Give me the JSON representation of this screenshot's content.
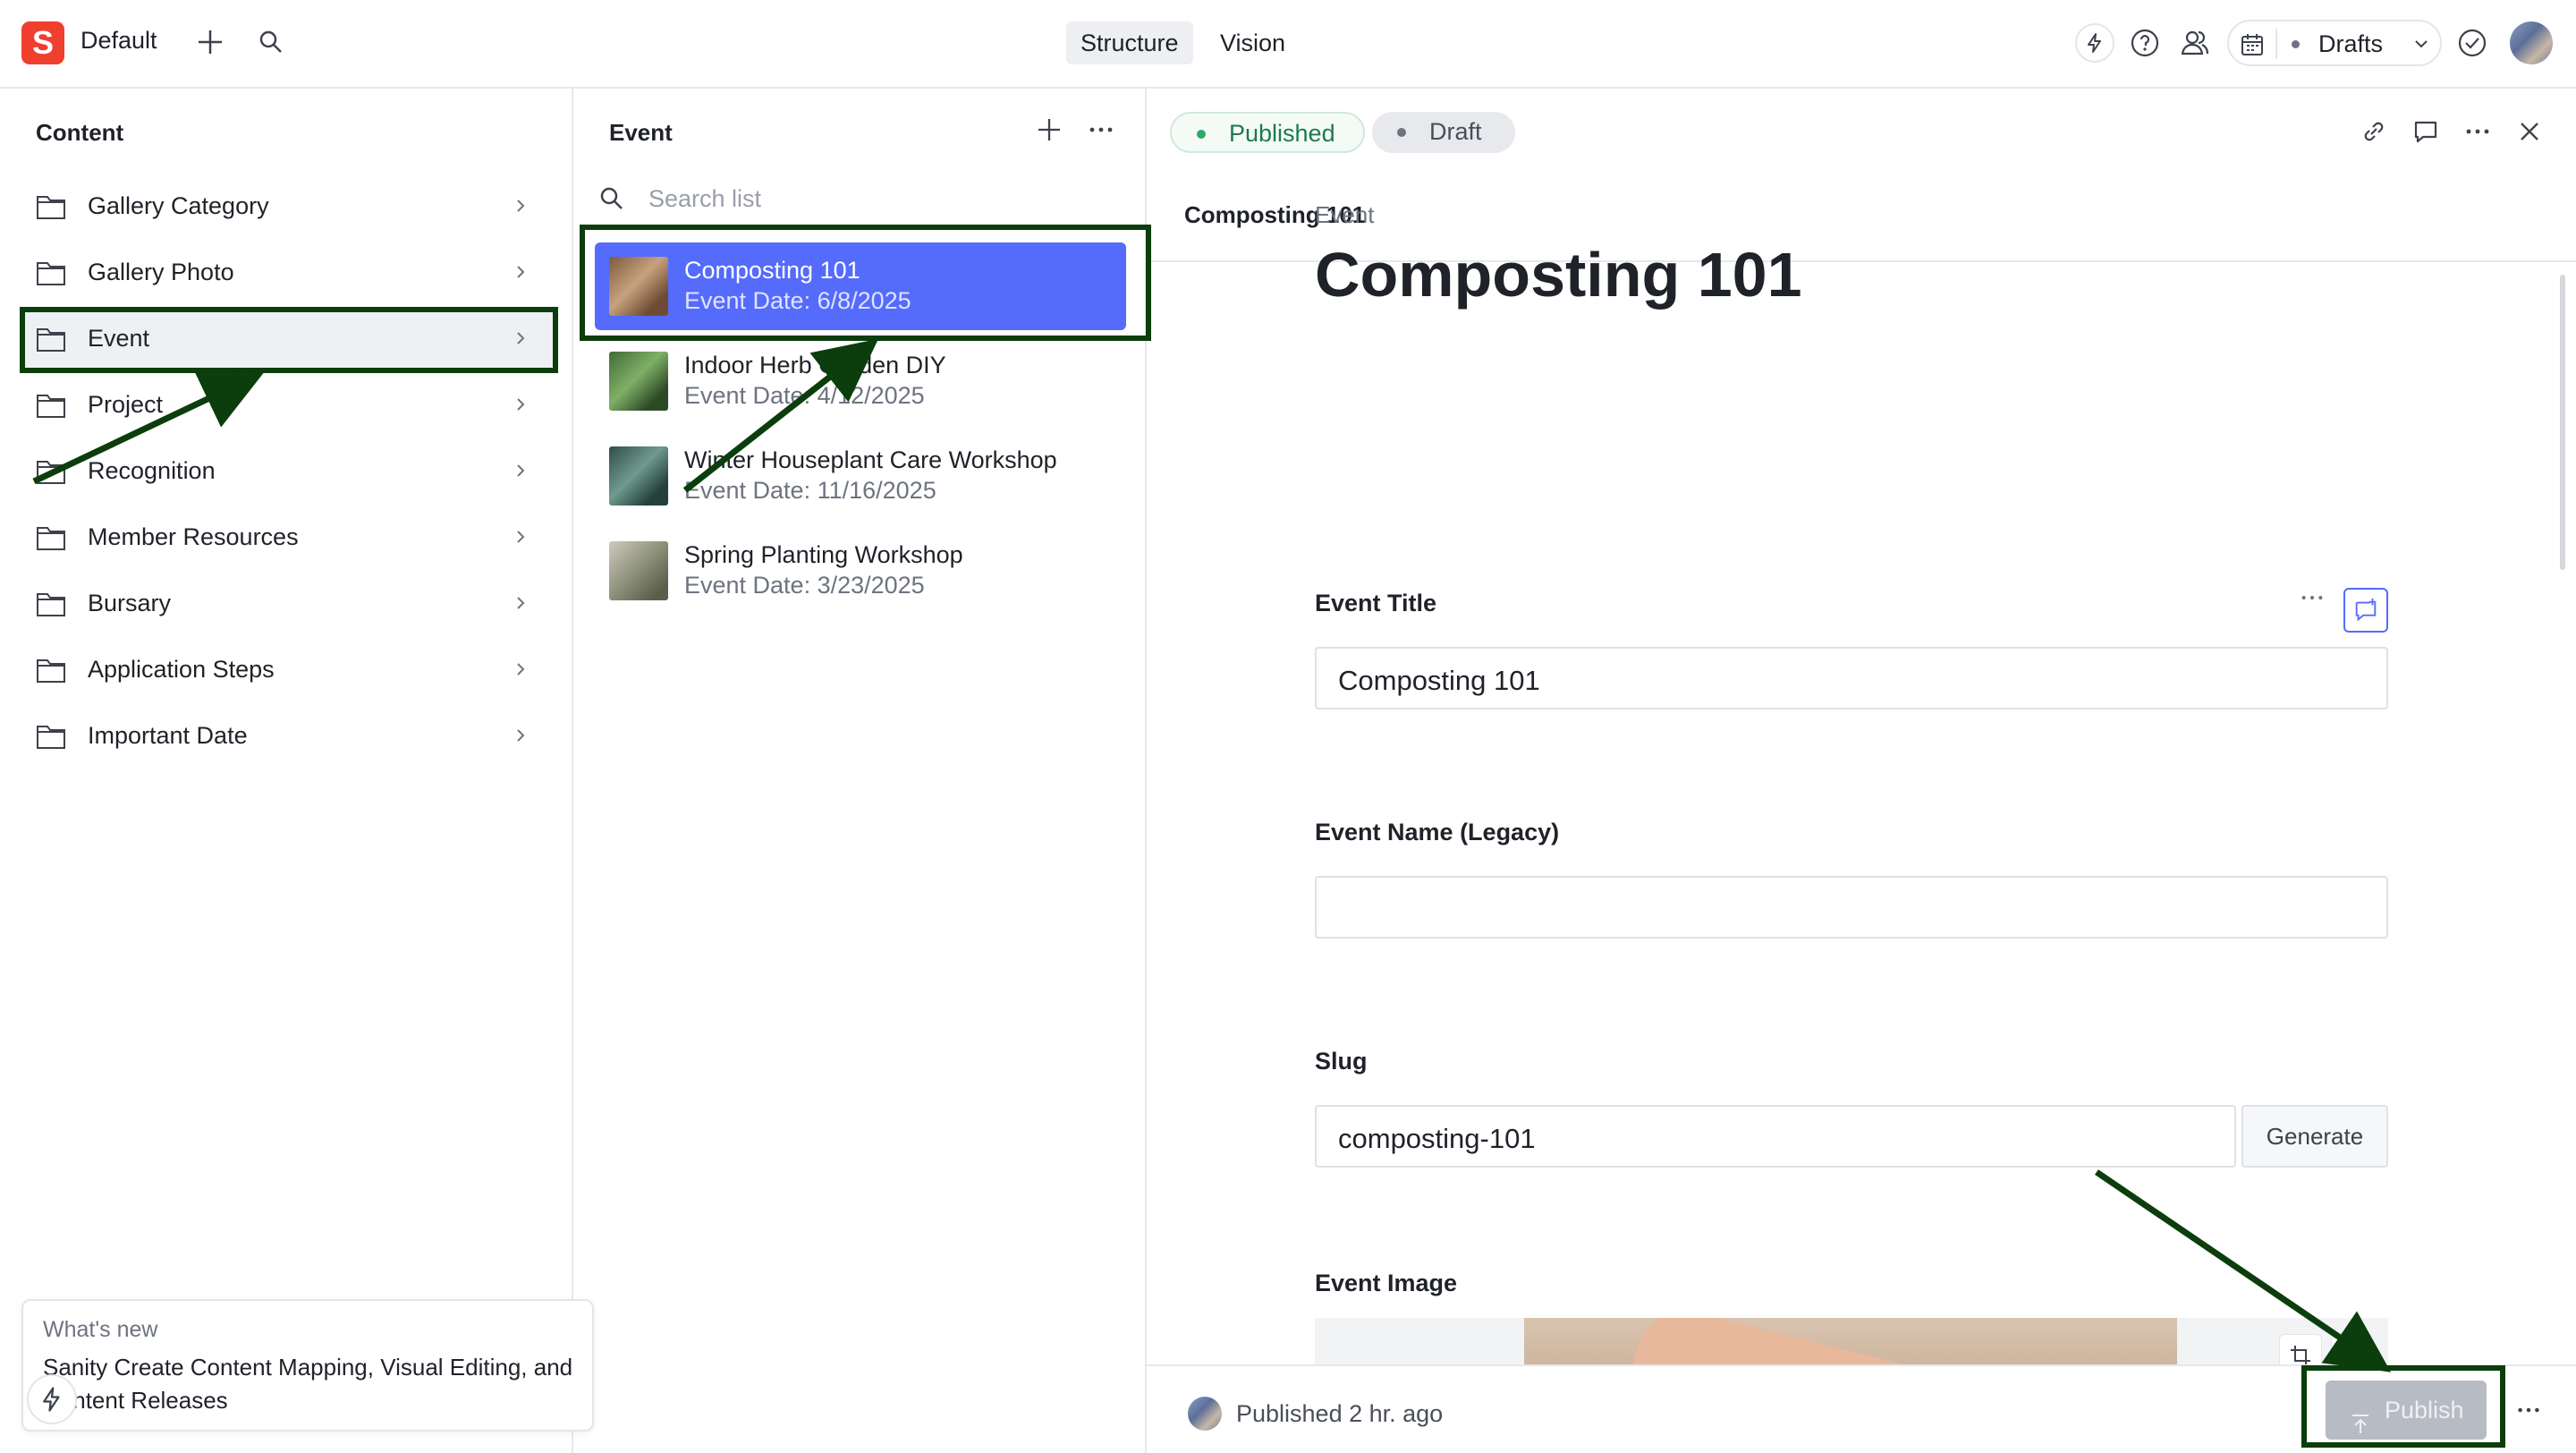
{
  "navbar": {
    "workspace": "Default",
    "tabs": [
      {
        "label": "Structure",
        "active": true
      },
      {
        "label": "Vision",
        "active": false
      }
    ],
    "perspective": "Drafts"
  },
  "content_pane": {
    "title": "Content",
    "items": [
      {
        "label": "Gallery Category"
      },
      {
        "label": "Gallery Photo"
      },
      {
        "label": "Event",
        "selected": true
      },
      {
        "label": "Project"
      },
      {
        "label": "Recognition"
      },
      {
        "label": "Member Resources"
      },
      {
        "label": "Bursary"
      },
      {
        "label": "Application Steps"
      },
      {
        "label": "Important Date"
      }
    ]
  },
  "whats_new": {
    "heading": "What's new",
    "text": "Sanity Create Content Mapping, Visual Editing, and Content Releases"
  },
  "event_pane": {
    "title": "Event",
    "search_placeholder": "Search list",
    "items": [
      {
        "title": "Composting 101",
        "subtitle": "Event Date: 6/8/2025",
        "selected": true
      },
      {
        "title": "Indoor Herb Garden DIY",
        "subtitle": "Event Date: 4/12/2025"
      },
      {
        "title": "Winter Houseplant Care Workshop",
        "subtitle": "Event Date: 11/16/2025"
      },
      {
        "title": "Spring Planting Workshop",
        "subtitle": "Event Date: 3/23/2025"
      }
    ]
  },
  "document": {
    "published_label": "Published",
    "draft_label": "Draft",
    "header_title": "Composting 101",
    "type_label": "Event",
    "title": "Composting 101",
    "fields": {
      "event_title": {
        "label": "Event Title",
        "value": "Composting 101"
      },
      "event_name_legacy": {
        "label": "Event Name (Legacy)",
        "value": ""
      },
      "slug": {
        "label": "Slug",
        "value": "composting-101",
        "generate_label": "Generate"
      },
      "event_image": {
        "label": "Event Image"
      }
    },
    "footer": {
      "status": "Published 2 hr. ago",
      "publish_label": "Publish"
    }
  },
  "colors": {
    "brand": "#f03e2f",
    "selection": "#556bfc",
    "published": "#2fa86a",
    "annotation": "#0c3d0c"
  }
}
